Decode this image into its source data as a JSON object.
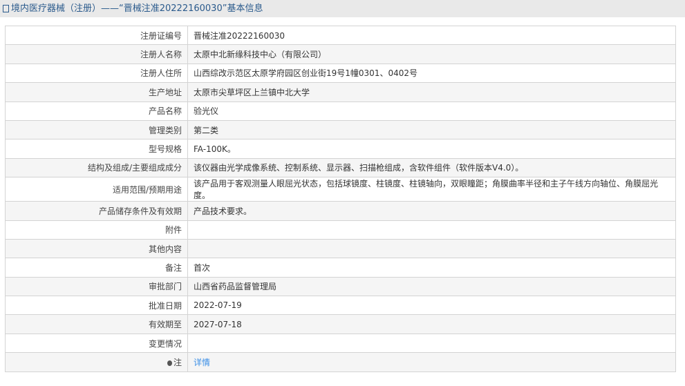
{
  "header": {
    "title": "境内医疗器械（注册）——“晋械注准20222160030”基本信息",
    "icon": "document-icon"
  },
  "rows": [
    {
      "label": "注册证编号",
      "value": "晋械注准20222160030"
    },
    {
      "label": "注册人名称",
      "value": "太原中北新缘科技中心（有限公司）"
    },
    {
      "label": "注册人住所",
      "value": "山西综改示范区太原学府园区创业街19号1幢0301、0402号"
    },
    {
      "label": "生产地址",
      "value": "太原市尖草坪区上兰镇中北大学"
    },
    {
      "label": "产品名称",
      "value": "验光仪"
    },
    {
      "label": "管理类别",
      "value": "第二类"
    },
    {
      "label": "型号规格",
      "value": "FA-100K。"
    },
    {
      "label": "结构及组成/主要组成成分",
      "value": "该仪器由光学成像系统、控制系统、显示器、扫描枪组成，含软件组件（软件版本V4.0）。"
    },
    {
      "label": "适用范围/预期用途",
      "value": "该产品用于客观测量人眼屈光状态，包括球镜度、柱镜度、柱镜轴向，双眼瞳距；角膜曲率半径和主子午线方向轴位、角膜屈光度。"
    },
    {
      "label": "产品储存条件及有效期",
      "value": "产品技术要求。"
    },
    {
      "label": "附件",
      "value": ""
    },
    {
      "label": "其他内容",
      "value": ""
    },
    {
      "label": "备注",
      "value": "首次"
    },
    {
      "label": "审批部门",
      "value": "山西省药品监督管理局"
    },
    {
      "label": "批准日期",
      "value": "2022-07-19"
    },
    {
      "label": "有效期至",
      "value": "2027-07-18"
    },
    {
      "label": "变更情况",
      "value": ""
    }
  ],
  "note": {
    "label": "注",
    "link": "详情",
    "icon": "lightbulb-icon",
    "link_color": "#3a8ee6"
  }
}
